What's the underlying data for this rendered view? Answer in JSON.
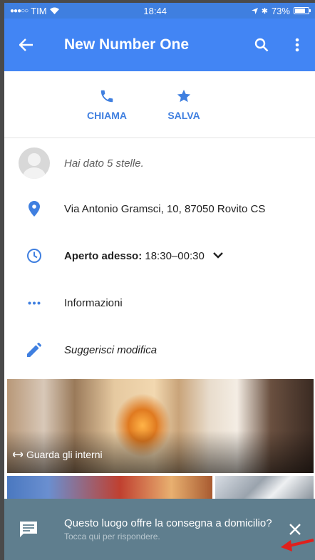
{
  "statusbar": {
    "carrier": "TIM",
    "time": "18:44",
    "battery": "73%"
  },
  "appbar": {
    "title": "New Number One"
  },
  "actions": {
    "call_label": "CHIAMA",
    "save_label": "SALVA"
  },
  "rows": {
    "rating": "Hai dato 5 stelle.",
    "address": "Via Antonio Gramsci, 10, 87050 Rovito CS",
    "hours_label": "Aperto adesso:",
    "hours_value": "18:30–00:30",
    "info": "Informazioni",
    "suggest": "Suggerisci modifica"
  },
  "photos": {
    "caption": "Guarda gli interni"
  },
  "snackbar": {
    "question": "Questo luogo offre la consegna a domicilio?",
    "hint": "Tocca qui per rispondere."
  },
  "colors": {
    "primary": "#4285f4",
    "accent": "#3f7fe0",
    "snackbar": "#5f7e8e",
    "annotation": "#e0201c"
  }
}
